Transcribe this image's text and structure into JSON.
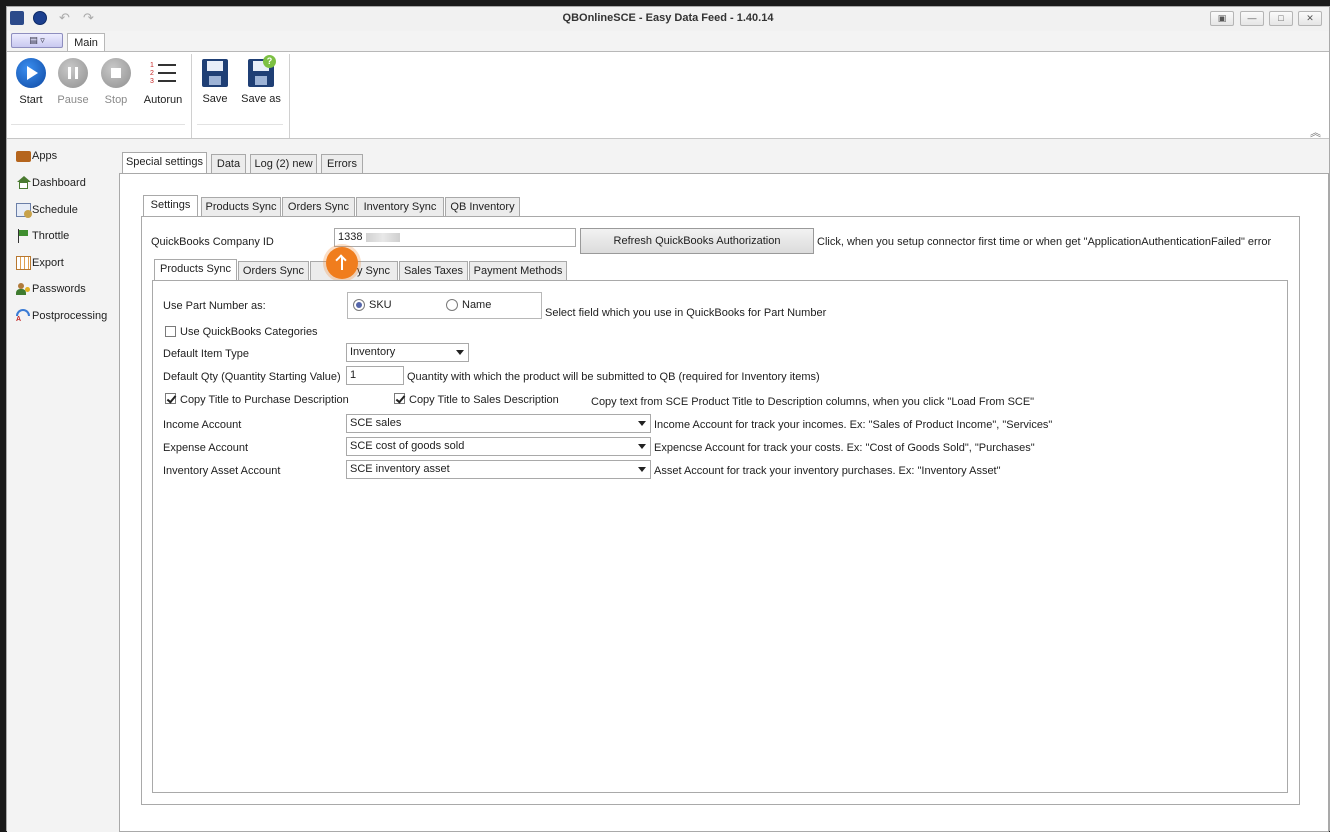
{
  "window": {
    "title": "QBOnlineSCE - Easy Data Feed - 1.40.14"
  },
  "ribbon": {
    "tab_main": "Main",
    "buttons": {
      "start": "Start",
      "pause": "Pause",
      "stop": "Stop",
      "autorun": "Autorun",
      "save": "Save",
      "save_as": "Save as"
    }
  },
  "sidebar": {
    "items": [
      "Apps",
      "Dashboard",
      "Schedule",
      "Throttle",
      "Export",
      "Passwords",
      "Postprocessing"
    ]
  },
  "outer_tabs": [
    "Special settings",
    "Data",
    "Log (2) new",
    "Errors"
  ],
  "settings_tabs": [
    "Settings",
    "Products Sync",
    "Orders Sync",
    "Inventory Sync",
    "QB Inventory"
  ],
  "company": {
    "label": "QuickBooks Company ID",
    "value": "1338",
    "refresh_button": "Refresh QuickBooks Authorization",
    "hint": "Click, when you setup connector first time or when get \"ApplicationAuthenticationFailed\" error"
  },
  "inner_tabs": [
    "Products Sync",
    "Orders Sync",
    "y Sync",
    "Sales Taxes",
    "Payment Methods"
  ],
  "form": {
    "part_number_label": "Use Part Number as:",
    "part_number_options": [
      "SKU",
      "Name"
    ],
    "part_number_selected": "SKU",
    "part_number_hint": "Select field which you use in QuickBooks for Part Number",
    "use_categories_label": "Use QuickBooks Categories",
    "use_categories_checked": false,
    "item_type_label": "Default Item Type",
    "item_type_value": "Inventory",
    "qty_label": "Default Qty (Quantity Starting Value)",
    "qty_value": "1",
    "qty_hint": "Quantity with which the product will be submitted to QB (required for Inventory items)",
    "copy_purchase_label": "Copy Title to Purchase Description",
    "copy_purchase_checked": true,
    "copy_sales_label": "Copy Title to Sales Description",
    "copy_sales_checked": true,
    "copy_hint": "Copy text from SCE Product Title to Description columns, when you click \"Load From SCE\"",
    "income_label": "Income Account",
    "income_value": "SCE sales",
    "income_hint": "Income Account for track your incomes. Ex: \"Sales of Product Income\", \"Services\"",
    "expense_label": "Expense Account",
    "expense_value": "SCE cost of goods sold",
    "expense_hint": "Expencse Account for track your costs. Ex: \"Cost of Goods Sold\", \"Purchases\"",
    "asset_label": "Inventory Asset Account",
    "asset_value": "SCE inventory asset",
    "asset_hint": "Asset Account for track your inventory purchases. Ex: \"Inventory Asset\""
  },
  "colors": {
    "accent_blue": "#1565c0",
    "overlay_orange": "#f07d1d"
  }
}
